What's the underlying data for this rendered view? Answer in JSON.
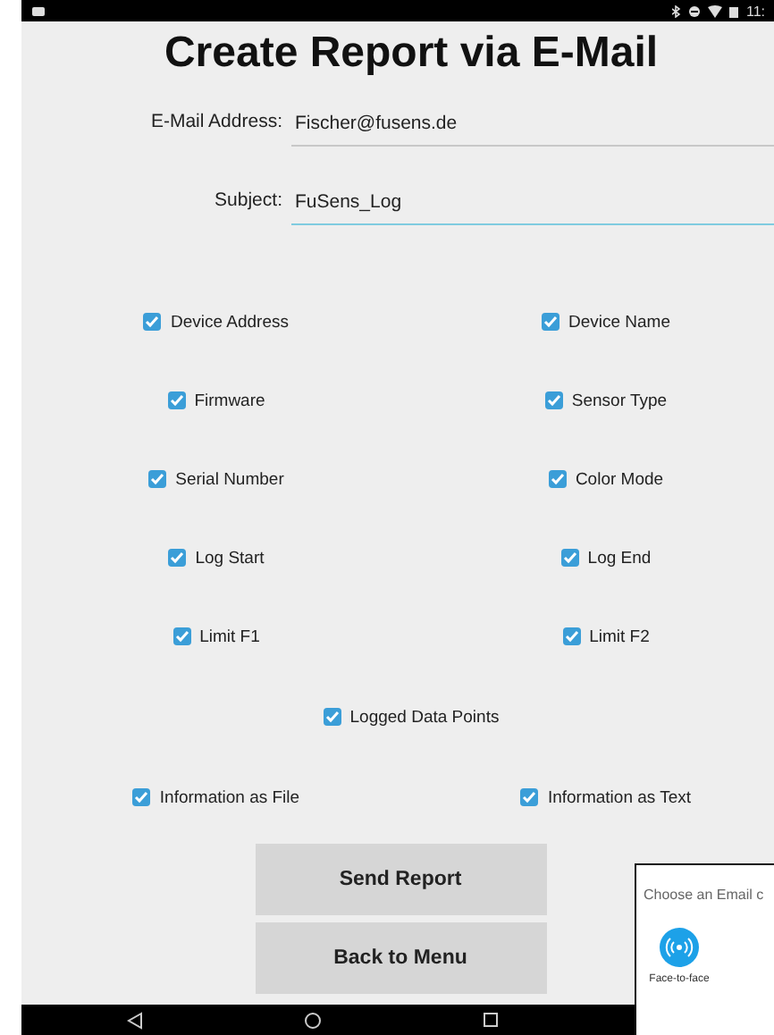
{
  "status_bar": {
    "time": "11:"
  },
  "title": "Create Report via E-Mail",
  "fields": [
    {
      "label": "E-Mail Address:",
      "value": "Fischer@fusens.de",
      "focused": false
    },
    {
      "label": "Subject:",
      "value": "FuSens_Log",
      "focused": true
    }
  ],
  "options": [
    {
      "label": "Device Address",
      "checked": true
    },
    {
      "label": "Device Name",
      "checked": true
    },
    {
      "label": "Firmware",
      "checked": true
    },
    {
      "label": "Sensor Type",
      "checked": true
    },
    {
      "label": "Serial Number",
      "checked": true
    },
    {
      "label": "Color Mode",
      "checked": true
    },
    {
      "label": "Log Start",
      "checked": true
    },
    {
      "label": "Log End",
      "checked": true
    },
    {
      "label": "Limit F1",
      "checked": true
    },
    {
      "label": "Limit F2",
      "checked": true
    }
  ],
  "logged_data_points": {
    "label": "Logged Data Points",
    "checked": true
  },
  "output_options": [
    {
      "label": "Information as File",
      "checked": true
    },
    {
      "label": "Information as Text",
      "checked": true
    }
  ],
  "buttons": [
    "Send Report",
    "Back to Menu"
  ],
  "chooser": {
    "title": "Choose an Email c",
    "apps": [
      {
        "label": "Face-to-face"
      }
    ]
  }
}
